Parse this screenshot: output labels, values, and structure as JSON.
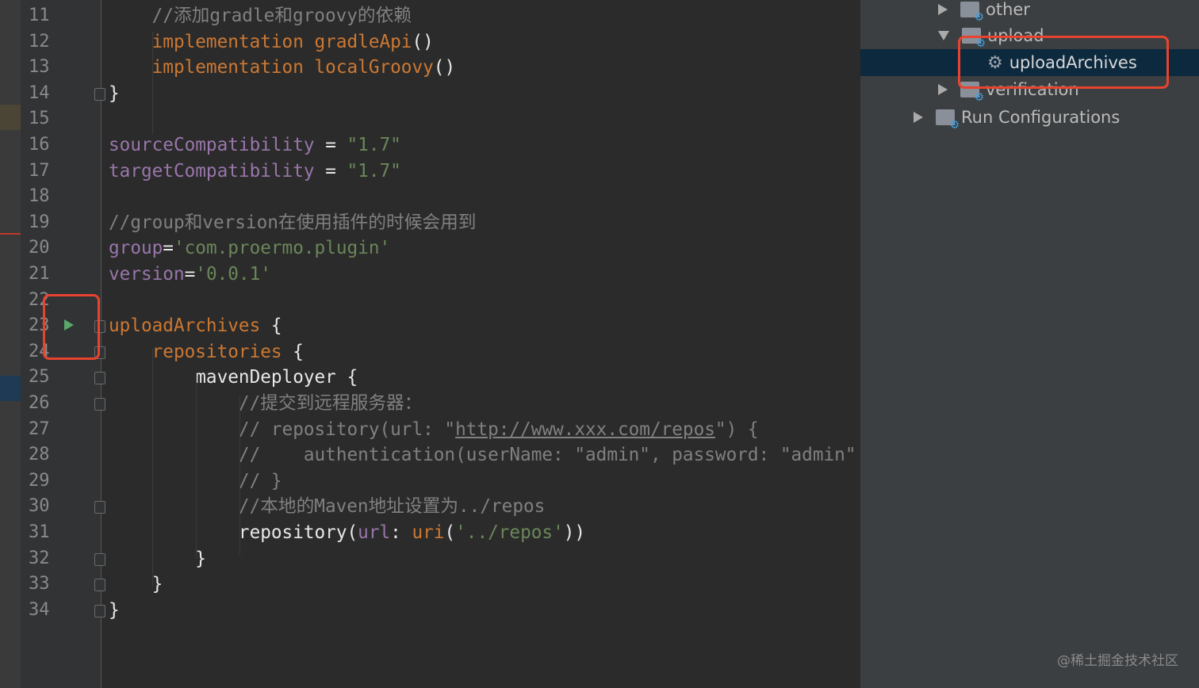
{
  "editor": {
    "line_numbers": [
      "11",
      "12",
      "13",
      "14",
      "15",
      "16",
      "17",
      "18",
      "19",
      "20",
      "21",
      "22",
      "23",
      "24",
      "25",
      "26",
      "27",
      "28",
      "29",
      "30",
      "31",
      "32",
      "33",
      "34"
    ],
    "lines": [
      [
        {
          "t": "    //添加gradle和groovy的依赖",
          "c": "c"
        }
      ],
      [
        {
          "t": "    implementation gradleApi",
          "c": "k"
        },
        {
          "t": "()",
          "c": "w"
        }
      ],
      [
        {
          "t": "    implementation localGroovy",
          "c": "k"
        },
        {
          "t": "()",
          "c": "w"
        }
      ],
      [
        {
          "t": "}",
          "c": "w"
        }
      ],
      [],
      [
        {
          "t": "sourceCompatibility",
          "c": "p"
        },
        {
          "t": " = ",
          "c": "w"
        },
        {
          "t": "\"1.7\"",
          "c": "s"
        }
      ],
      [
        {
          "t": "targetCompatibility",
          "c": "p"
        },
        {
          "t": " = ",
          "c": "w"
        },
        {
          "t": "\"1.7\"",
          "c": "s"
        }
      ],
      [],
      [
        {
          "t": "//group和version在使用插件的时候会用到",
          "c": "c"
        }
      ],
      [
        {
          "t": "group",
          "c": "p"
        },
        {
          "t": "=",
          "c": "w"
        },
        {
          "t": "'com.proermo.plugin'",
          "c": "s"
        }
      ],
      [
        {
          "t": "version",
          "c": "p"
        },
        {
          "t": "=",
          "c": "w"
        },
        {
          "t": "'0.0.1'",
          "c": "s"
        }
      ],
      [],
      [
        {
          "t": "uploadArchives",
          "c": "k"
        },
        {
          "t": " {",
          "c": "w"
        }
      ],
      [
        {
          "t": "    repositories",
          "c": "k"
        },
        {
          "t": " {",
          "c": "w"
        }
      ],
      [
        {
          "t": "        mavenDeployer {",
          "c": "w"
        }
      ],
      [
        {
          "t": "            //提交到远程服务器：",
          "c": "c"
        }
      ],
      [
        {
          "t": "            // repository(url: \"",
          "c": "c"
        },
        {
          "t": "http://www.xxx.com/repos",
          "c": "u"
        },
        {
          "t": "\") {",
          "c": "c"
        }
      ],
      [
        {
          "t": "            //    authentication(userName: \"admin\", password: \"admin\"",
          "c": "c"
        }
      ],
      [
        {
          "t": "            // }",
          "c": "c"
        }
      ],
      [
        {
          "t": "            //本地的Maven地址设置为../repos",
          "c": "c"
        }
      ],
      [
        {
          "t": "            repository(",
          "c": "w"
        },
        {
          "t": "url",
          "c": "p"
        },
        {
          "t": ": ",
          "c": "w"
        },
        {
          "t": "uri",
          "c": "k"
        },
        {
          "t": "(",
          "c": "w"
        },
        {
          "t": "'../repos'",
          "c": "s"
        },
        {
          "t": "))",
          "c": "w"
        }
      ],
      [
        {
          "t": "        }",
          "c": "w"
        }
      ],
      [
        {
          "t": "    }",
          "c": "w"
        }
      ],
      [
        {
          "t": "}",
          "c": "w"
        }
      ]
    ],
    "fold_lines": [
      "14",
      "23",
      "24",
      "25",
      "26",
      "30",
      "32",
      "33",
      "34"
    ]
  },
  "gradle_panel": {
    "items": [
      {
        "label": "other",
        "expanded": false
      },
      {
        "label": "upload",
        "expanded": true
      },
      {
        "label": "uploadArchives",
        "selected": true
      },
      {
        "label": "verification",
        "expanded": false
      },
      {
        "label": "Run Configurations",
        "expanded": false
      }
    ]
  },
  "watermark": "@稀土掘金技术社区"
}
